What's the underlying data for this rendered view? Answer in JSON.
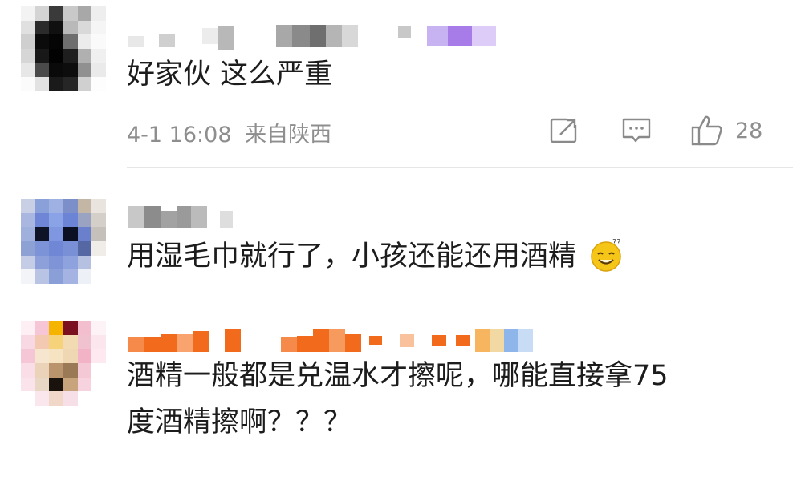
{
  "comments": [
    {
      "text": "好家伙 这么严重",
      "time": "4-1 16:08",
      "location": "来自陕西",
      "likes": "28"
    },
    {
      "text": "用湿毛巾就行了，小孩还能还用酒精",
      "emoji": "sleepy-smile-emoji"
    },
    {
      "text_line1": "酒精一般都是兑温水才擦呢，哪能直接拿75",
      "text_line2": "度酒精擦啊？？？"
    }
  ],
  "icons": {
    "share": "share-icon",
    "comment": "comment-icon",
    "like": "thumbs-up-icon"
  },
  "colors": {
    "text": "#1c1c1c",
    "meta": "#8e8e8e",
    "name_orange": "#f26b1d",
    "name_purple": "#a77be8"
  }
}
